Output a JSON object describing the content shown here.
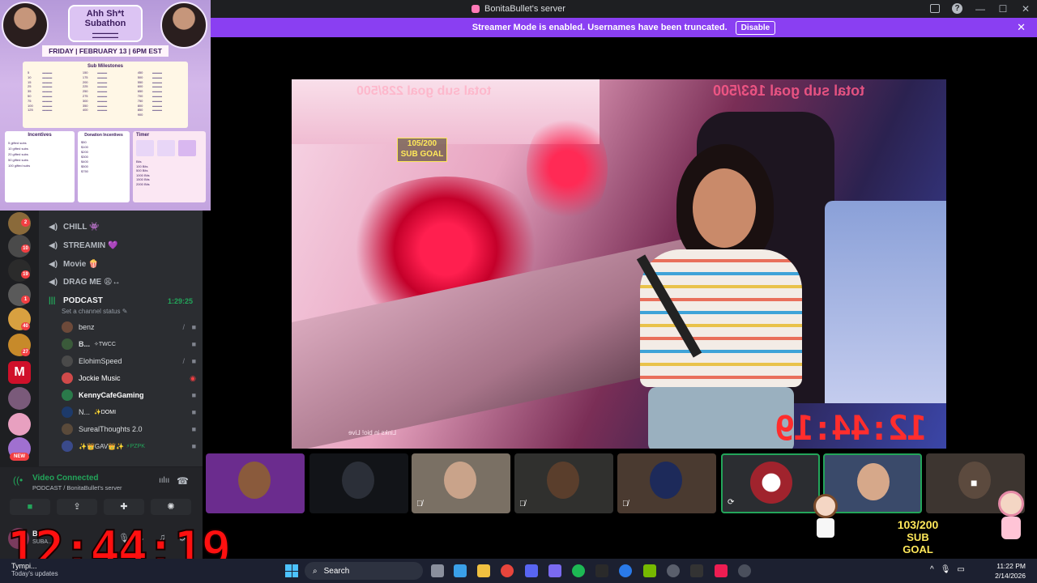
{
  "window": {
    "title": "BonitaBullet's server",
    "controls": [
      "—",
      "☐",
      "✕"
    ]
  },
  "streamer_bar": {
    "message": "Streamer Mode is enabled. Usernames have been truncated.",
    "disable_label": "Disable",
    "close": "✕"
  },
  "overlay": {
    "title_line1": "Ahh Sh*t",
    "title_line2": "Subathon",
    "date": "FRIDAY | FEBRUARY 13 | 6PM EST",
    "milestones_title": "Sub Milestones",
    "milestone_numbers": [
      "5",
      "10",
      "15",
      "25",
      "35",
      "50",
      "75",
      "100",
      "125",
      "150",
      "175",
      "200",
      "225",
      "250",
      "275",
      "300",
      "350",
      "400",
      "450",
      "500",
      "550",
      "600",
      "650",
      "700",
      "750",
      "800",
      "850",
      "900"
    ],
    "incentives_title": "Incentives",
    "incentives": [
      "5 gifted subs",
      "10 gifted subs",
      "20 gifted subs",
      "50 gifted subs",
      "100 gifted subs"
    ],
    "donation_title": "Donation Incentives",
    "donations": [
      "$50",
      "$100",
      "$200",
      "$300",
      "$400",
      "$500",
      "$750"
    ],
    "timer_title": "Timer",
    "timer_rows": [
      "Bits",
      "100 Bits",
      "500 Bits",
      "1000 Bits",
      "1500 Bits",
      "2000 Bits"
    ]
  },
  "server_rail": {
    "badges": [
      "2",
      "10",
      "19",
      "1",
      "40",
      "27",
      "NEW"
    ]
  },
  "channels": {
    "items": [
      {
        "name": "CHILL",
        "emoji": "👾"
      },
      {
        "name": "STREAMIN",
        "emoji": "💜"
      },
      {
        "name": "Movie",
        "emoji": "🍿"
      },
      {
        "name": "DRAG ME",
        "emoji": "😩↔"
      }
    ],
    "active": {
      "name": "PODCAST",
      "status": "Set a channel status",
      "time": "1:29:25"
    },
    "users": [
      {
        "name": "benz",
        "tag": ""
      },
      {
        "name": "B...",
        "tag": "✧TWCC"
      },
      {
        "name": "ElohimSpeed",
        "tag": ""
      },
      {
        "name": "Jockie Music",
        "tag": ""
      },
      {
        "name": "KennyCafeGaming",
        "tag": ""
      },
      {
        "name": "N...",
        "tag": "✨DOMI"
      },
      {
        "name": "SurealThoughts 2.0",
        "tag": ""
      },
      {
        "name": "✨👑GAV👑✨",
        "tag": "⚡PZPK"
      }
    ]
  },
  "voice_panel": {
    "title": "Video Connected",
    "subtitle": "PODCAST / BonitaBullet's server"
  },
  "user_bar": {
    "name": "B...",
    "status": "SUBA..."
  },
  "clock": "12:44:19",
  "stream": {
    "top_goal_count": "105/200",
    "top_goal_label": "SUB GOAL",
    "mirror_left": "total sub goal 228/500",
    "mirror_right": "total sub goal 163/500",
    "mirror_clock": "12:44:19",
    "caption": "Links in bio! Live"
  },
  "sub_goal": {
    "count": "103/200",
    "label": "SUB GOAL"
  },
  "taskbar": {
    "weather_title": "Tympi...",
    "weather_sub": "Today's updates",
    "search_placeholder": "Search",
    "time": "11:22 PM",
    "date": "2/14/2026"
  },
  "colors": {
    "streamer_bar": "#8a3ff2",
    "green_status": "#23a55a",
    "clock_red": "#ff1010",
    "goal_yellow": "#ffe85a"
  }
}
